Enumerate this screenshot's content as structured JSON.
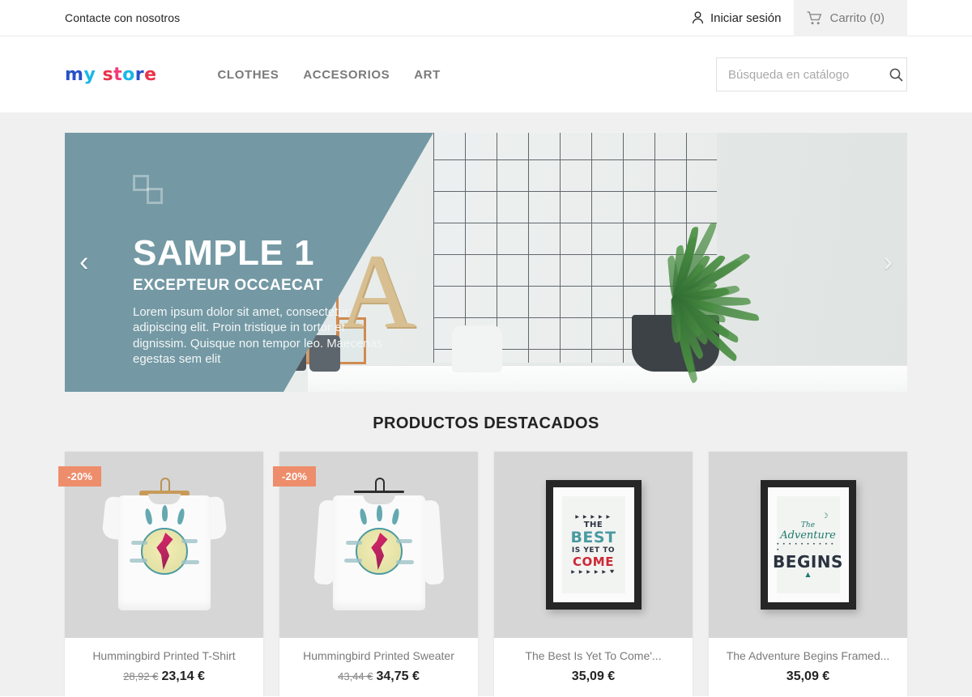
{
  "topbar": {
    "contact_label": "Contacte con nosotros",
    "signin_label": "Iniciar sesión",
    "signin_icon": "user-icon",
    "cart_label": "Carrito (0)",
    "cart_icon": "shopping-cart-icon"
  },
  "header": {
    "logo_parts": [
      {
        "text": "m",
        "color": "#2850c8"
      },
      {
        "text": "y",
        "color": "#18b8e8"
      },
      {
        "text": " ",
        "color": "#ffffff"
      },
      {
        "text": "s",
        "color": "#e8334a"
      },
      {
        "text": "t",
        "color": "#f03c78"
      },
      {
        "text": "o",
        "color": "#18b8e8"
      },
      {
        "text": "r",
        "color": "#2850c8"
      },
      {
        "text": "e",
        "color": "#e8334a"
      }
    ],
    "logo_text": "my store",
    "nav": [
      {
        "label": "CLOTHES"
      },
      {
        "label": "ACCESORIOS"
      },
      {
        "label": "ART"
      }
    ],
    "search": {
      "placeholder": "Búsqueda en catálogo",
      "value": "",
      "icon": "search-icon"
    }
  },
  "carousel": {
    "prev_icon": "chevron-left-icon",
    "next_icon": "chevron-right-icon",
    "prev_glyph": "‹",
    "next_glyph": "›",
    "overlay_color": "#7499a4",
    "slide": {
      "badge_icon": "squares-placeholder-icon",
      "title": "SAMPLE 1",
      "subtitle": "EXCEPTEUR OCCAECAT",
      "description": "Lorem ipsum dolor sit amet, consectetur adipiscing elit. Proin tristique in tortor et dignissim. Quisque non tempor leo. Maecenas egestas sem elit"
    }
  },
  "featured": {
    "section_title": "PRODUCTOS DESTACADOS",
    "badge_color": "#ee8d6b",
    "products": [
      {
        "name": "Hummingbird Printed T-Shirt",
        "badge": "-20%",
        "old_price": "28,92 €",
        "price": "23,14 €",
        "art": "tshirt-hummingbird"
      },
      {
        "name": "Hummingbird Printed Sweater",
        "badge": "-20%",
        "old_price": "43,44 €",
        "price": "34,75 €",
        "art": "sweater-hummingbird"
      },
      {
        "name": "The Best Is Yet To Come'...",
        "badge": "",
        "old_price": "",
        "price": "35,09 €",
        "art": "framed-poster-best",
        "poster": {
          "top_arrows": "▶ ▶ ▶ ▶ ▶",
          "line1": "THE",
          "line2": "BEST",
          "line3": "IS YET TO",
          "line4": "COME",
          "bottom_arrows": "▶ ▶ ▶ ▶ ▶ ♥"
        }
      },
      {
        "name": "The Adventure Begins Framed...",
        "badge": "",
        "old_price": "",
        "price": "35,09 €",
        "art": "framed-poster-adventure",
        "poster": {
          "moon": "☽",
          "line1": "The",
          "line2": "Adventure",
          "dots": "• • • • • • • • • • •",
          "line3": "BEGINS",
          "tent": "▲"
        }
      }
    ]
  }
}
